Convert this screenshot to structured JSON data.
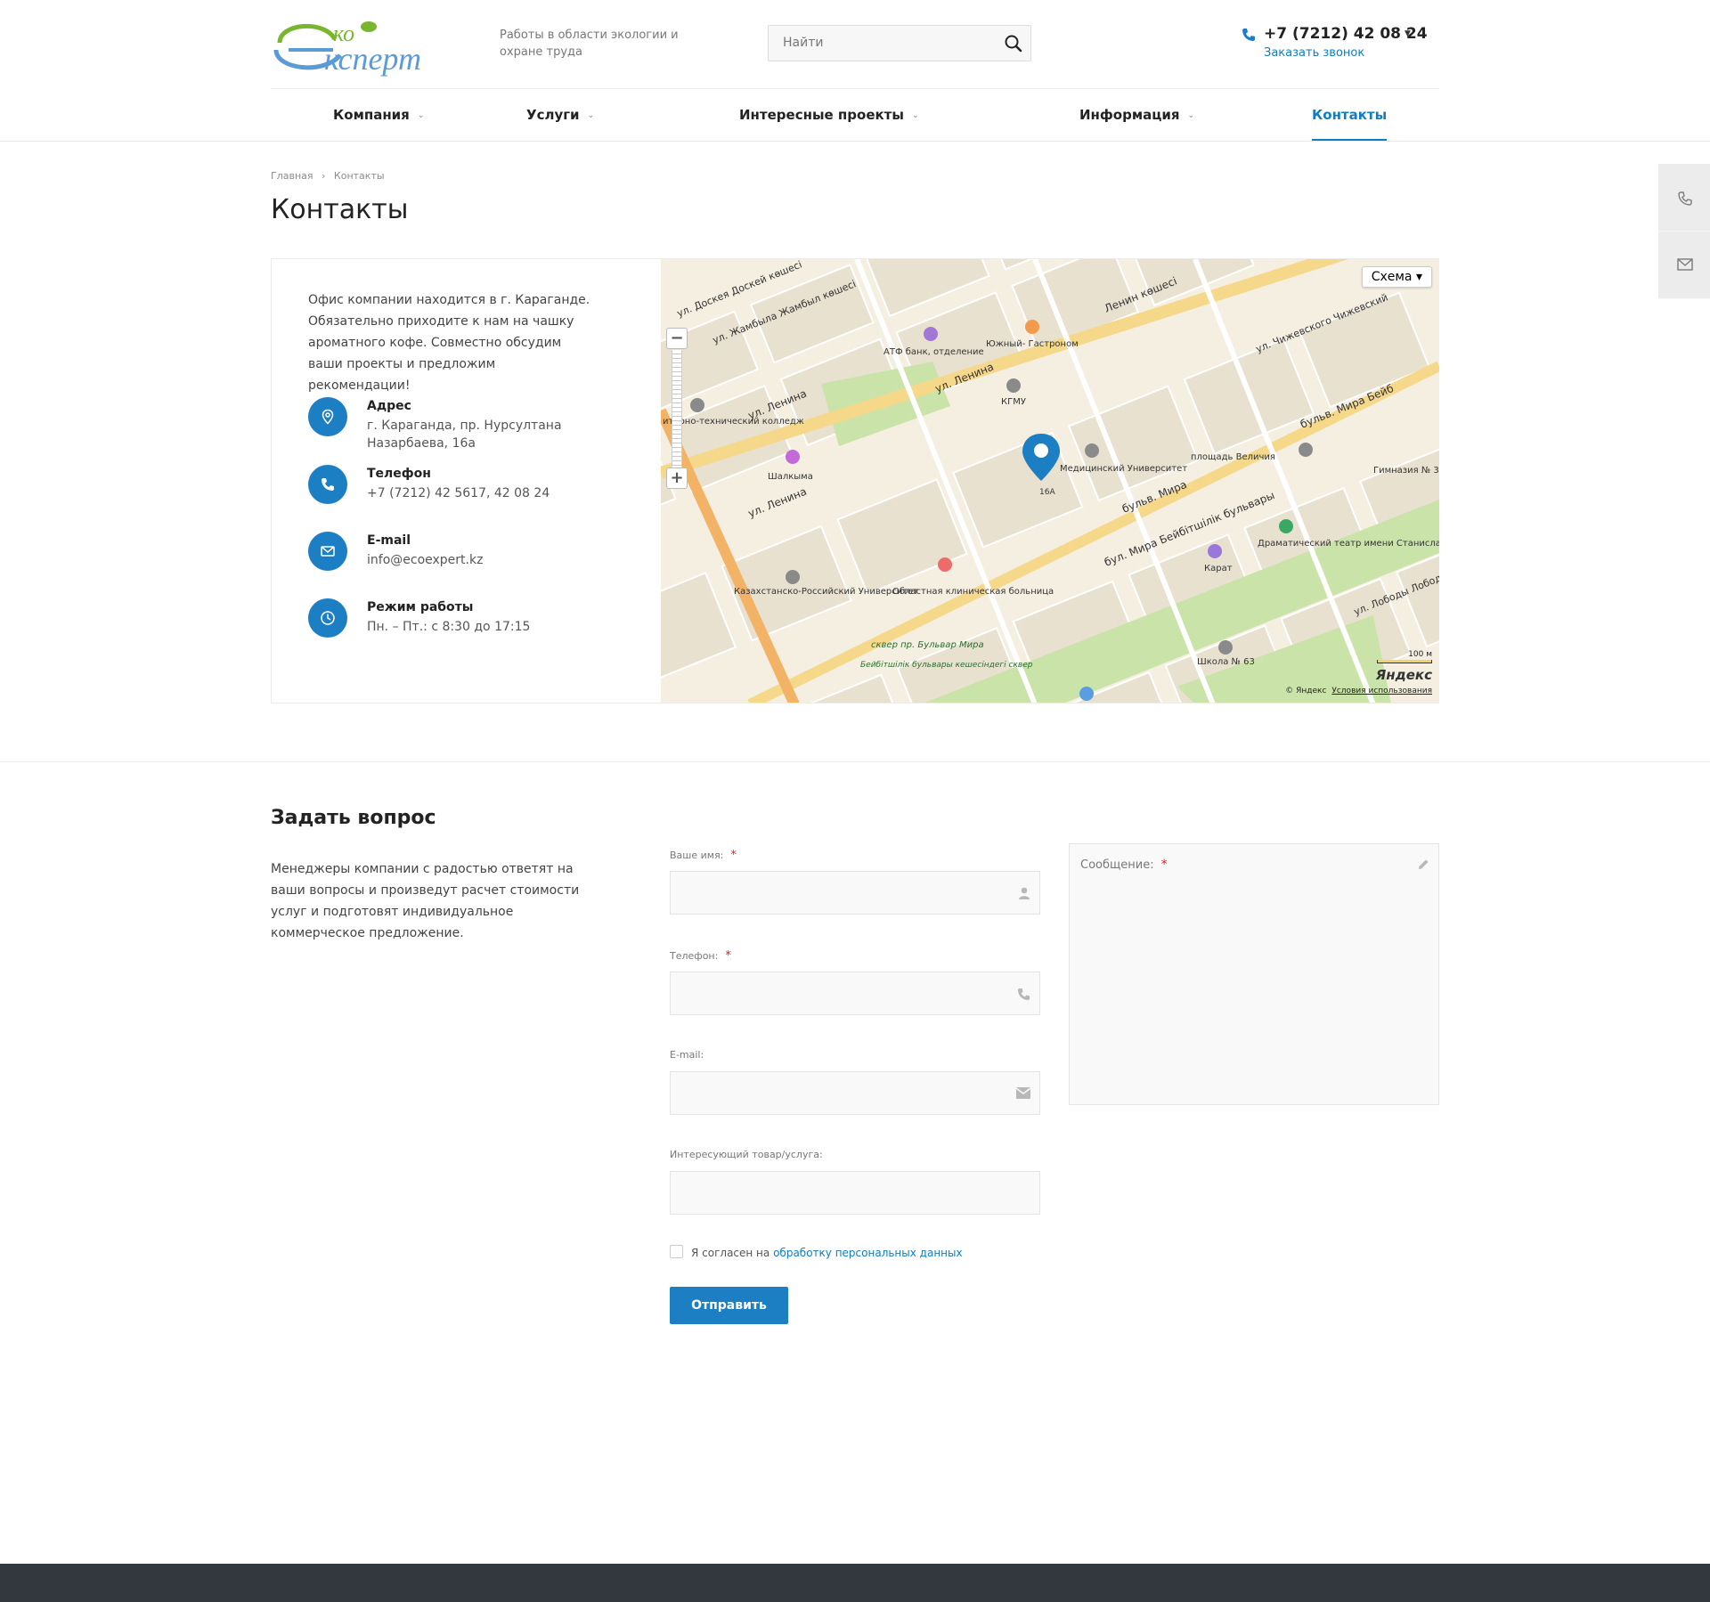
{
  "header": {
    "tagline": "Работы в области экологии и охране труда",
    "search_placeholder": "Найти",
    "phone": "+7 (7212) 42 08 24",
    "callback": "Заказать звонок"
  },
  "nav": [
    {
      "label": "Компания"
    },
    {
      "label": "Услуги"
    },
    {
      "label": "Интересные проекты"
    },
    {
      "label": "Информация"
    },
    {
      "label": "Контакты"
    }
  ],
  "breadcrumb": {
    "home": "Главная",
    "current": "Контакты"
  },
  "page_title": "Контакты",
  "office_text": "Офис компании находится в г. Караганде. Обязательно приходите к нам на чашку ароматного кофе. Совместно обсудим ваши проекты и предложим рекомендации!",
  "contacts": {
    "address": {
      "title": "Адрес",
      "value": "г. Караганда, пр. Нурсултана Назарбаева, 16а"
    },
    "phone": {
      "title": "Телефон",
      "value": "+7 (7212) 42 5617, 42 08 24"
    },
    "email": {
      "title": "E-mail",
      "value": "info@ecoexpert.kz"
    },
    "hours": {
      "title": "Режим работы",
      "value": "Пн. – Пт.: с 8:30 до 17:15"
    }
  },
  "map": {
    "type_button": "Схема",
    "scale": "100 м",
    "logo": "Яндекс",
    "copyright": "© Яндекс",
    "terms": "Условия использования",
    "labels": {
      "street1": "ул. Ленина",
      "street2": "ул. Ленина",
      "street3": "ул. Ленина",
      "street4": "бульв. Мира",
      "street5": "бул. Мира Бейбітшілік бульвары",
      "street6": "бульв. Мира Бейб",
      "street7": "Ленин көшесі",
      "street8": "ул. Чижевского Чижевский",
      "street9": "ул. Жамбыла Жамбыл көшесі",
      "street10": "ул. Доскея Доскей көшесі",
      "street11": "ул. Лободы Лобод",
      "poi1": "АТФ банк, отделение",
      "poi2": "Южный- Гастроном",
      "poi3": "КГМУ",
      "poi4": "Медицинский Университет",
      "poi5": "площадь Величия",
      "poi6": "Гимназия № 3",
      "poi7": "Шалкыма",
      "poi8": "итарно-технический колледж",
      "poi9": "Областная клиническая больница",
      "poi10": "Казахстанско-Российский Университет",
      "poi11": "Карат",
      "poi12": "Драматический театр имени Станиславского",
      "poi13": "Школа № 63",
      "poi14": "сквер пр. Бульвар Мира",
      "poi15": "Бейбітшілік бульвары кешесіндегі сквер",
      "pin_label": "16A"
    }
  },
  "ask": {
    "title": "Задать вопрос",
    "text": "Менеджеры компании с радостью ответят на ваши вопросы и произведут расчет стоимости услуг и подготовят индивидуальное коммерческое предложение.",
    "name_label": "Ваше имя:",
    "phone_label": "Телефон:",
    "email_label": "E-mail:",
    "service_label": "Интересующий товар/услуга:",
    "message_label": "Сообщение:",
    "required_mark": "*",
    "agree_text": "Я согласен на",
    "agree_link": "обработку персональных данных",
    "submit": "Отправить"
  },
  "colors": {
    "accent": "#1c7ec3",
    "footer": "#33373e",
    "logo_green": "#7ab530",
    "logo_blue": "#5b9bd5"
  }
}
